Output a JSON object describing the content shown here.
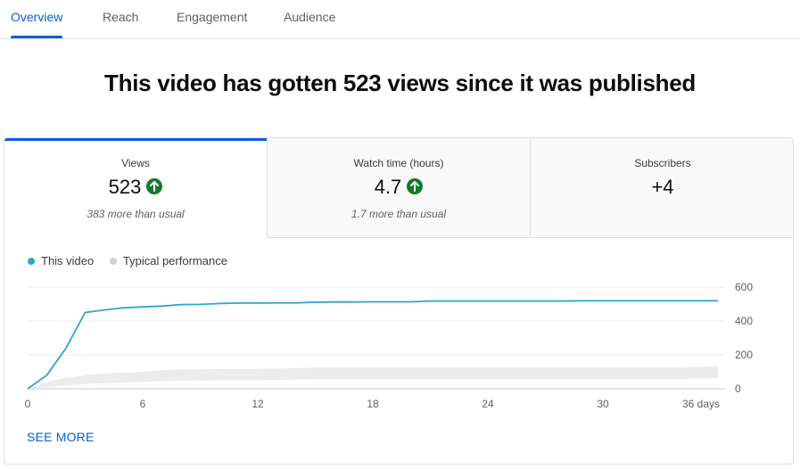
{
  "tabs": [
    {
      "label": "Overview",
      "active": true
    },
    {
      "label": "Reach"
    },
    {
      "label": "Engagement"
    },
    {
      "label": "Audience"
    }
  ],
  "headline": "This video has gotten 523 views since it was published",
  "metrics": [
    {
      "title": "Views",
      "value": "523",
      "trend": "up",
      "note": "383 more than usual",
      "active": true
    },
    {
      "title": "Watch time (hours)",
      "value": "4.7",
      "trend": "up",
      "note": "1.7 more than usual"
    },
    {
      "title": "Subscribers",
      "value": "+4",
      "note": ""
    }
  ],
  "legend": {
    "this_video": "This video",
    "typical": "Typical performance"
  },
  "see_more": "SEE MORE",
  "colors": {
    "accent": "#065fd4",
    "series_line": "#2ea6cc",
    "typical_band": "#ececec",
    "trend_up": "#117a2b"
  },
  "chart_data": {
    "type": "line",
    "x_unit": "days",
    "x_ticks": [
      0,
      6,
      12,
      18,
      24,
      30,
      36
    ],
    "x_tick_labels": [
      "0",
      "6",
      "12",
      "18",
      "24",
      "30",
      "36 days"
    ],
    "y_ticks": [
      0,
      200,
      400,
      600
    ],
    "y_tick_labels": [
      "0",
      "200",
      "400",
      "600"
    ],
    "xlim": [
      0,
      36
    ],
    "ylim": [
      0,
      600
    ],
    "grid": true,
    "legend_position": "top-left",
    "series": [
      {
        "name": "This video",
        "x": [
          0,
          1,
          2,
          3,
          4,
          5,
          6,
          7,
          8,
          9,
          10,
          11,
          12,
          13,
          14,
          15,
          16,
          17,
          18,
          19,
          20,
          21,
          22,
          23,
          24,
          25,
          26,
          27,
          28,
          29,
          30,
          31,
          32,
          33,
          34,
          35,
          36
        ],
        "values": [
          0,
          80,
          240,
          450,
          465,
          478,
          483,
          488,
          497,
          498,
          503,
          506,
          506,
          507,
          507,
          511,
          512,
          512,
          513,
          513,
          513,
          518,
          518,
          518,
          518,
          518,
          518,
          518,
          518,
          519,
          519,
          519,
          519,
          519,
          519,
          519,
          519
        ]
      },
      {
        "name": "Typical performance",
        "type": "band",
        "x": [
          0,
          1,
          2,
          3,
          4,
          5,
          6,
          7,
          8,
          9,
          10,
          11,
          12,
          13,
          14,
          15,
          16,
          17,
          18,
          19,
          20,
          21,
          22,
          23,
          24,
          25,
          26,
          27,
          28,
          29,
          30,
          31,
          32,
          33,
          34,
          35,
          36
        ],
        "low": [
          0,
          10,
          20,
          28,
          32,
          36,
          40,
          44,
          46,
          48,
          50,
          50,
          50,
          52,
          54,
          56,
          58,
          58,
          58,
          58,
          58,
          58,
          58,
          58,
          58,
          58,
          58,
          58,
          58,
          58,
          58,
          58,
          58,
          58,
          58,
          60,
          62
        ],
        "high": [
          0,
          40,
          65,
          80,
          90,
          95,
          100,
          110,
          115,
          115,
          118,
          118,
          118,
          120,
          122,
          125,
          125,
          125,
          125,
          125,
          125,
          125,
          125,
          125,
          125,
          125,
          125,
          125,
          125,
          125,
          125,
          125,
          125,
          125,
          125,
          128,
          135
        ]
      }
    ]
  }
}
